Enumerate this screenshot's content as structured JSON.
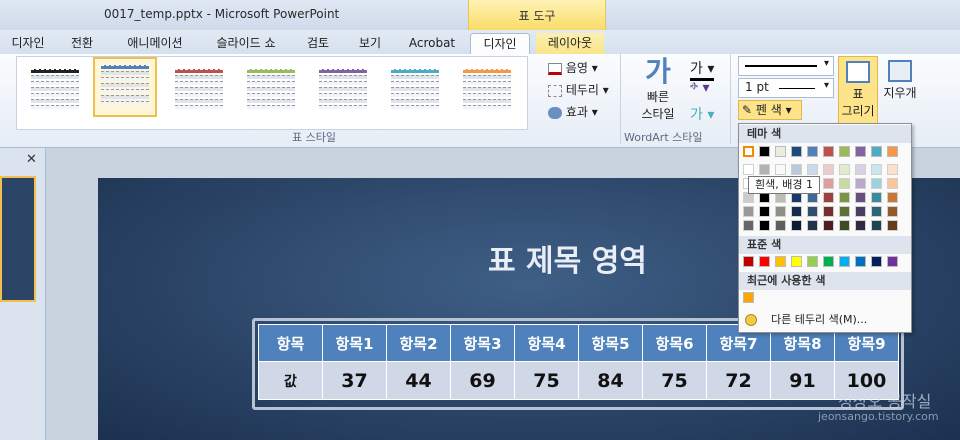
{
  "titlebar": {
    "title": "0017_temp.pptx  -  Microsoft PowerPoint"
  },
  "context": {
    "header": "표 도구"
  },
  "tabs": [
    {
      "label": "디자인"
    },
    {
      "label": "전환"
    },
    {
      "label": "애니메이션"
    },
    {
      "label": "슬라이드 쇼"
    },
    {
      "label": "검토"
    },
    {
      "label": "보기"
    },
    {
      "label": "Acrobat"
    },
    {
      "label": "디자인",
      "active": true
    },
    {
      "label": "레이아웃"
    }
  ],
  "ribbon": {
    "styles_group_label": "표 스타일",
    "shading_label": "음영",
    "borders_label": "테두리",
    "effects_label": "효과",
    "wordart_quick": "빠른",
    "wordart_quick2": "스타일",
    "wordart_group_label": "WordArt 스타일",
    "pen_weight": "1 pt",
    "pen_color_label": "펜 색",
    "draw_table_label": "표",
    "draw_table_label2": "그리기",
    "eraser_label": "지우개",
    "style_colors": [
      "#222222",
      "#4f81bd",
      "#c0504d",
      "#9bbb59",
      "#8064a2",
      "#4bacc6",
      "#f79646"
    ]
  },
  "menu": {
    "theme_colors_label": "테마 색",
    "standard_colors_label": "표준 색",
    "recent_colors_label": "최근에 사용한 색",
    "more_borders_label": "다른 테두리 색(M)...",
    "tooltip": "흰색, 배경 1",
    "theme_top": [
      "#ffffff",
      "#000000",
      "#eeece1",
      "#1f497d",
      "#4f81bd",
      "#c0504d",
      "#9bbb59",
      "#8064a2",
      "#4bacc6",
      "#f79646"
    ],
    "standard": [
      "#c00000",
      "#ff0000",
      "#ffc000",
      "#ffff00",
      "#92d050",
      "#00b050",
      "#00b0f0",
      "#0070c0",
      "#002060",
      "#7030a0"
    ],
    "recent": [
      "#ffa500"
    ]
  },
  "slide": {
    "title": "표 제목 영역",
    "table": {
      "header": [
        "항목",
        "항목1",
        "항목2",
        "항목3",
        "항목4",
        "항목5",
        "항목6",
        "항목7",
        "항목8",
        "항목9"
      ],
      "row": [
        "값",
        "37",
        "44",
        "69",
        "75",
        "84",
        "75",
        "72",
        "91",
        "100"
      ]
    },
    "watermark": "정상오 공작실",
    "watermark_url": "jeonsango.tistory.com"
  }
}
